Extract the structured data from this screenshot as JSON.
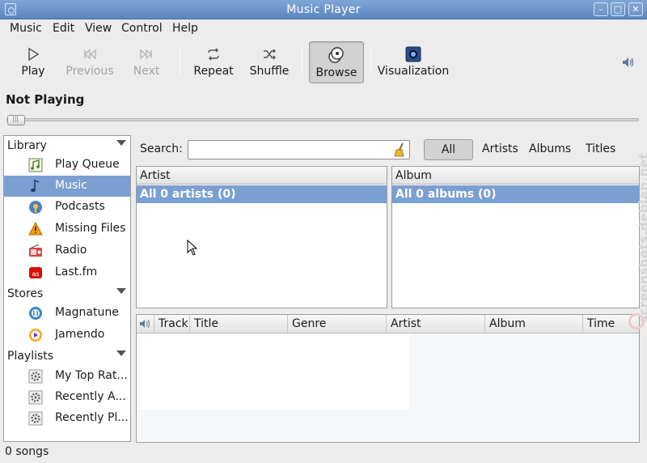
{
  "window": {
    "title": "Music Player"
  },
  "menu": [
    "Music",
    "Edit",
    "View",
    "Control",
    "Help"
  ],
  "toolbar": {
    "play": "Play",
    "previous": "Previous",
    "next": "Next",
    "repeat": "Repeat",
    "shuffle": "Shuffle",
    "browse": "Browse",
    "visualization": "Visualization"
  },
  "now_playing": "Not Playing",
  "sidebar": {
    "library": {
      "label": "Library",
      "items": [
        "Play Queue",
        "Music",
        "Podcasts",
        "Missing Files",
        "Radio",
        "Last.fm"
      ]
    },
    "stores": {
      "label": "Stores",
      "items": [
        "Magnatune",
        "Jamendo"
      ]
    },
    "playlists": {
      "label": "Playlists",
      "items": [
        "My Top Rat...",
        "Recently A...",
        "Recently Pl..."
      ]
    },
    "selected": "Music"
  },
  "search": {
    "label": "Search:",
    "value": ""
  },
  "filters": {
    "all": "All",
    "artists": "Artists",
    "albums": "Albums",
    "titles": "Titles"
  },
  "artist_pane": {
    "header": "Artist",
    "row": "All 0 artists (0)"
  },
  "album_pane": {
    "header": "Album",
    "row": "All 0 albums (0)"
  },
  "tracks": {
    "columns": [
      "Track",
      "Title",
      "Genre",
      "Artist",
      "Album",
      "Time"
    ]
  },
  "status": "0 songs",
  "watermark": "screenshots.debian.net"
}
